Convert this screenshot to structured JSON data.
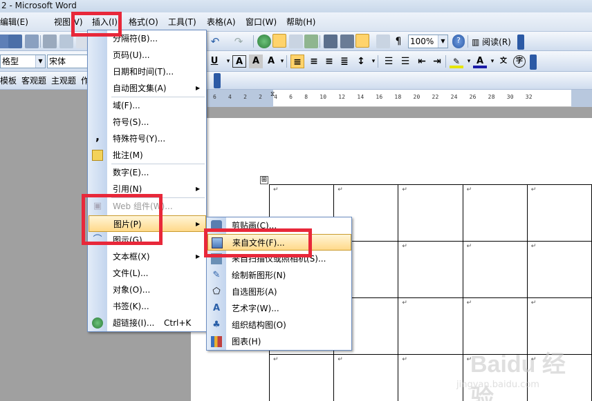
{
  "window": {
    "title": "2 - Microsoft Word"
  },
  "menubar": {
    "items": [
      "编辑(E)",
      "视图(V)",
      "插入(I)",
      "格式(O)",
      "工具(T)",
      "表格(A)",
      "窗口(W)",
      "帮助(H)"
    ]
  },
  "toolbar1": {
    "zoom": "100%",
    "read_label": "阅读(R)"
  },
  "toolbar2": {
    "style": "格型",
    "font": "宋体"
  },
  "toolbar3": {
    "items": [
      "模板",
      "客观题",
      "主观题",
      "作"
    ]
  },
  "ruler": {
    "numbers": "6 4 2 2 4 6 8 10 12 14 16 18 20 22 24 26 28 30 32"
  },
  "insert_menu": {
    "items": [
      {
        "label": "分隔符(B)...",
        "icon": ""
      },
      {
        "label": "页码(U)...",
        "icon": ""
      },
      {
        "label": "日期和时间(T)...",
        "icon": ""
      },
      {
        "label": "自动图文集(A)",
        "icon": "",
        "submenu": true
      },
      {
        "label": "域(F)...",
        "icon": ""
      },
      {
        "label": "符号(S)...",
        "icon": ""
      },
      {
        "label": "特殊符号(Y)...",
        "icon": "comma-icon"
      },
      {
        "label": "批注(M)",
        "icon": "comment-icon"
      },
      {
        "label": "数字(E)...",
        "icon": ""
      },
      {
        "label": "引用(N)",
        "icon": "",
        "submenu": true
      },
      {
        "label": "Web 组件(W)...",
        "icon": "web-component-icon",
        "disabled": true
      },
      {
        "label": "图片(P)",
        "icon": "",
        "submenu": true,
        "highlighted": true
      },
      {
        "label": "图示(G)...",
        "icon": "diagram-icon"
      },
      {
        "label": "文本框(X)",
        "icon": "",
        "submenu": true
      },
      {
        "label": "文件(L)...",
        "icon": ""
      },
      {
        "label": "对象(O)...",
        "icon": ""
      },
      {
        "label": "书签(K)...",
        "icon": ""
      },
      {
        "label": "超链接(I)...",
        "icon": "hyperlink-icon",
        "shortcut": "Ctrl+K"
      }
    ]
  },
  "picture_submenu": {
    "items": [
      {
        "label": "剪贴画(C)...",
        "icon": "clipart-icon"
      },
      {
        "label": "来自文件(F)...",
        "icon": "picture-file-icon",
        "highlighted": true
      },
      {
        "label": "来自扫描仪或照相机(S)...",
        "icon": "scanner-icon"
      },
      {
        "label": "绘制新图形(N)",
        "icon": "drawing-icon"
      },
      {
        "label": "自选图形(A)",
        "icon": "autoshape-icon"
      },
      {
        "label": "艺术字(W)...",
        "icon": "wordart-icon"
      },
      {
        "label": "组织结构图(O)",
        "icon": "org-chart-icon"
      },
      {
        "label": "图表(H)",
        "icon": "chart-icon"
      }
    ]
  },
  "document": {
    "cell_mark": "↵"
  },
  "watermark": {
    "text": "Baidu 经验",
    "url": "jingyan.baidu.com"
  }
}
